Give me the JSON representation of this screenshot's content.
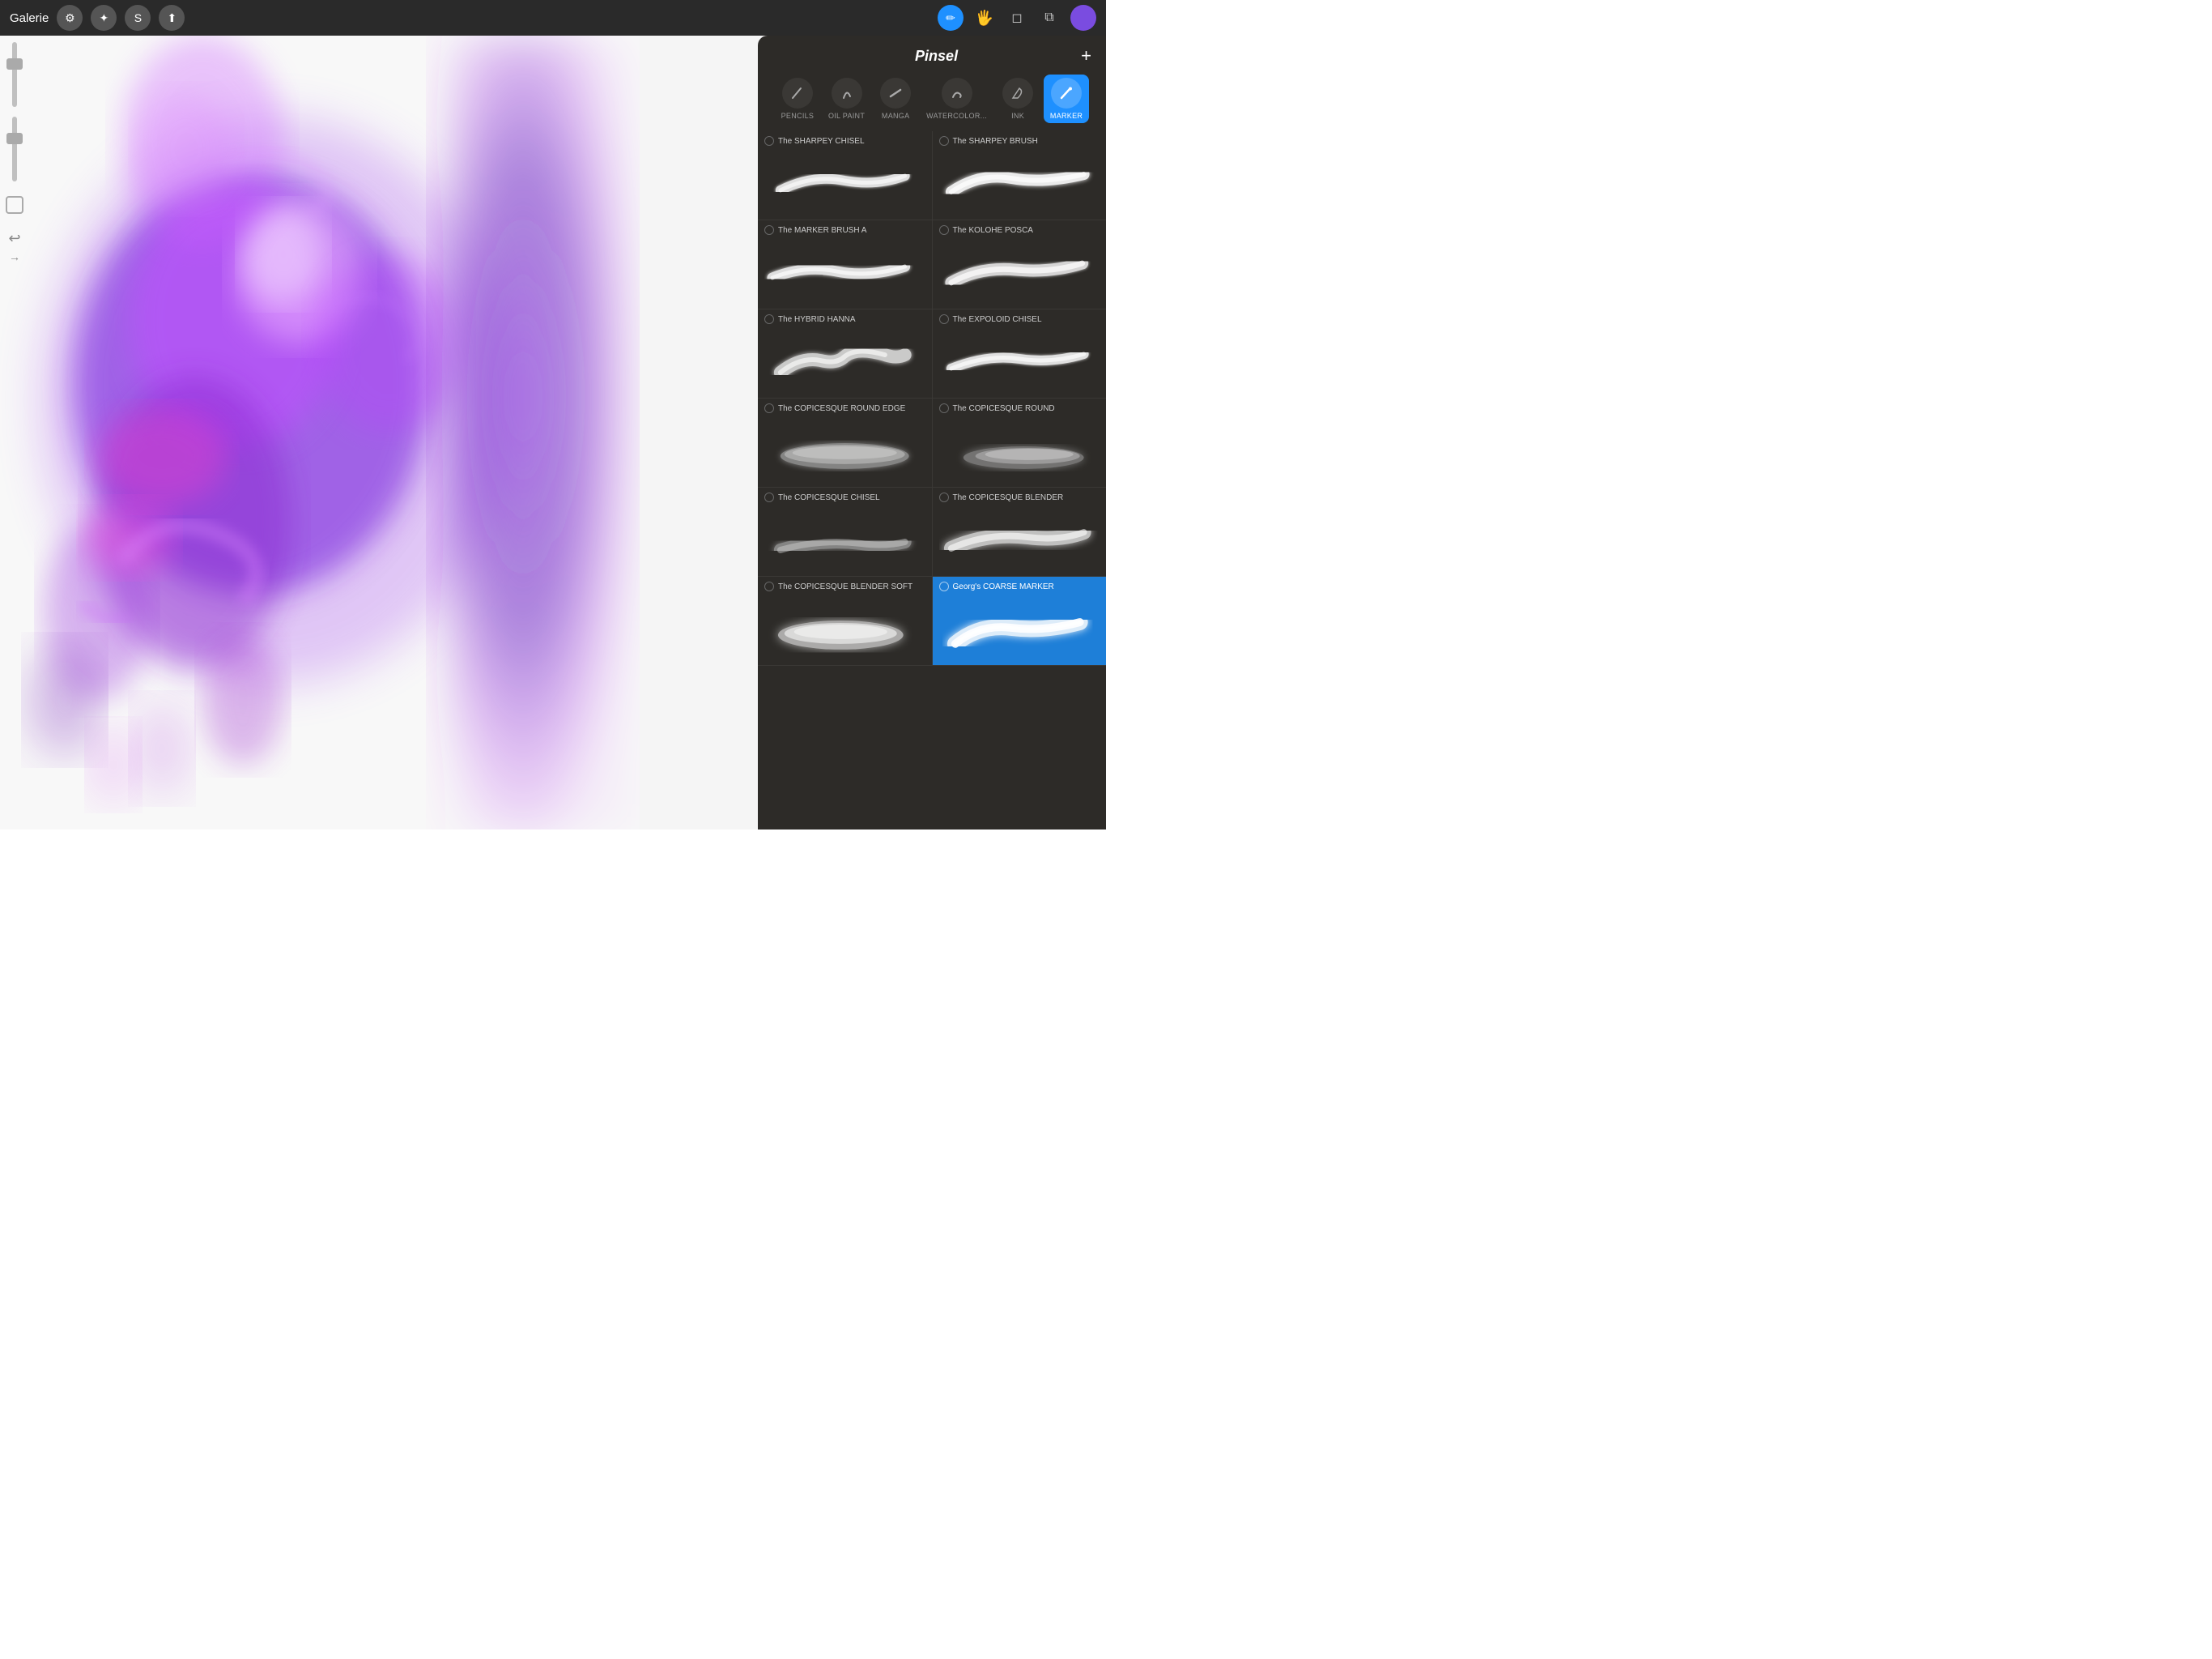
{
  "toolbar": {
    "galerie_label": "Galerie",
    "tools": [
      {
        "name": "wrench",
        "symbol": "🔧"
      },
      {
        "name": "adjust",
        "symbol": "✦"
      },
      {
        "name": "select",
        "symbol": "S"
      },
      {
        "name": "transform",
        "symbol": "✈"
      }
    ],
    "right_tools": [
      {
        "name": "pen",
        "symbol": "✒"
      },
      {
        "name": "smudge",
        "symbol": "🖐"
      },
      {
        "name": "eraser",
        "symbol": "◻"
      },
      {
        "name": "layers",
        "symbol": "⧉"
      }
    ],
    "color": "#7a4ce0"
  },
  "panel": {
    "title": "Pinsel",
    "add_label": "+",
    "categories": [
      {
        "id": "pencils",
        "label": "PENCILS",
        "active": false
      },
      {
        "id": "oil_paint",
        "label": "OIL PAINT",
        "active": false
      },
      {
        "id": "manga",
        "label": "MANGA",
        "active": false
      },
      {
        "id": "watercolor",
        "label": "WATERCOLOR...",
        "active": false
      },
      {
        "id": "ink",
        "label": "INK",
        "active": false
      },
      {
        "id": "marker",
        "label": "MARKER",
        "active": true
      }
    ],
    "brushes": [
      {
        "left": {
          "name": "The SHARPEY CHISEL",
          "stroke_type": "chisel_white"
        },
        "right": {
          "name": "The SHARPEY BRUSH",
          "stroke_type": "brush_white"
        }
      },
      {
        "left": {
          "name": "The MARKER BRUSH A",
          "stroke_type": "marker_white"
        },
        "right": {
          "name": "The KOLOHE POSCA",
          "stroke_type": "posca_white"
        }
      },
      {
        "left": {
          "name": "The HYBRID HANNA",
          "stroke_type": "hybrid_white"
        },
        "right": {
          "name": "The EXPOLOID CHISEL",
          "stroke_type": "expoloid_white"
        }
      },
      {
        "left": {
          "name": "The COPICESQUE ROUND EDGE",
          "stroke_type": "copicesque_gray"
        },
        "right": {
          "name": "The COPICESQUE ROUND",
          "stroke_type": "copicesque_round_gray"
        }
      },
      {
        "left": {
          "name": "The COPICESQUE CHISEL",
          "stroke_type": "copicesque_chisel_gray"
        },
        "right": {
          "name": "The COPICESQUE BLENDER",
          "stroke_type": "copicesque_blender_white"
        }
      },
      {
        "left": {
          "name": "The COPICESQUE BLENDER SOFT",
          "stroke_type": "copicesque_soft_white"
        },
        "right": {
          "name": "Georg's COARSE MARKER",
          "stroke_type": "coarse_marker_white",
          "selected": true
        }
      }
    ]
  }
}
